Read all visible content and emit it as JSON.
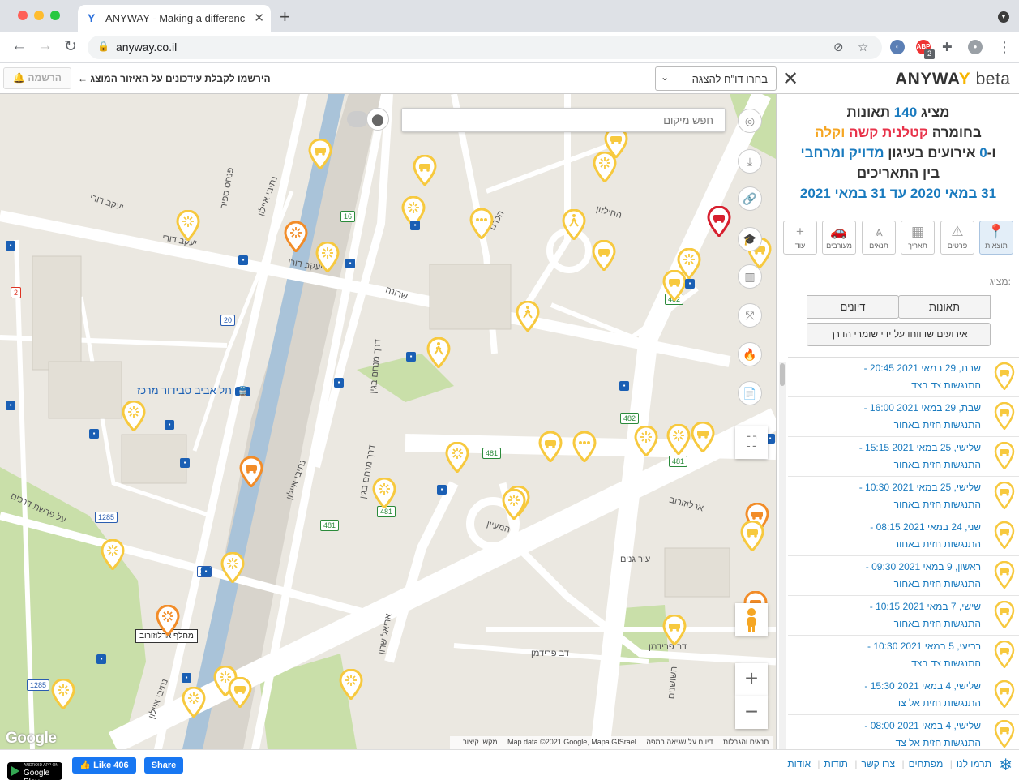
{
  "browser": {
    "tab_title": "ANYWAY - Making a difference",
    "url": "anyway.co.il",
    "extension_badge": "2"
  },
  "header": {
    "logo_main": "ANYWA",
    "logo_y": "Y",
    "logo_beta": "beta",
    "report_select_label": "בחרו דו\"ח להצגה",
    "register_label": "הרשמה",
    "register_text": "הירשמו לקבלת עידכונים על האיזור המוצג ←"
  },
  "map": {
    "search_placeholder": "חפש מיקום",
    "interchange_label": "מחלף ארלוזורוב",
    "station_label": "תל אביב סבידור מרכז",
    "attribution": {
      "report_error": "דיווח על שגיאה במפה",
      "terms": "תנאים והגבלות",
      "data": "Map data ©2021 Google, Mapa GISrael",
      "shortcuts": "מקשי קיצור"
    },
    "google_logo": "Google",
    "streets": [
      "יעקב דורי",
      "יעקב דורי",
      "יעקב דורי",
      "נתיבי איילון",
      "נתיבי איילון",
      "נתיבי איילון",
      "דרך מנחם בגין",
      "דרך מנחם בגין",
      "ארלוזורוב",
      "אריאל שרון",
      "דב פרידמן",
      "דב פרידמן",
      "עיר גנים",
      "פנחס ספיר",
      "שרונה",
      "הכרם",
      "החילזון",
      "המעיין",
      "על פרשת דרכים",
      "השושנים"
    ],
    "road_numbers": [
      "20",
      "20",
      "482",
      "482",
      "481",
      "481",
      "481",
      "16",
      "2",
      "1285",
      "1285"
    ]
  },
  "sidebar": {
    "summary": {
      "line1_prefix": "מציג",
      "count": "140",
      "line1_suffix": "תאונות",
      "line2_prefix": "בחומרה",
      "severe_fatal": "קטלנית קשה",
      "and_light": "וקלה",
      "line3_prefix": "ו-",
      "events_count": "0",
      "line3_mid": "אירועים בעיגון",
      "precision": "מדויק ומרחבי",
      "line4": "בין התאריכים",
      "dates": "31 במאי 2020 עד 31 במאי 2021"
    },
    "tabs": [
      {
        "label": "תוצאות",
        "icon": "pin-icon",
        "glyph": "📍"
      },
      {
        "label": "פרטים",
        "icon": "warning-icon",
        "glyph": "⚠"
      },
      {
        "label": "תאריך",
        "icon": "calendar-icon",
        "glyph": "▦"
      },
      {
        "label": "תנאים",
        "icon": "road-icon",
        "glyph": "⩓"
      },
      {
        "label": "מעורבים",
        "icon": "car-icon",
        "glyph": "🚗"
      },
      {
        "label": "עוד",
        "icon": "plus-icon",
        "glyph": "+"
      }
    ],
    "showing_label": "מציג:",
    "accidents_btn": "תאונות",
    "discussions_btn": "דיונים",
    "road_safety_btn": "אירועים שדווחו על ידי שומרי הדרך",
    "items": [
      {
        "date": "שבת, 29 במאי 2021 20:45 -",
        "type": "התנגשות צד בצד"
      },
      {
        "date": "שבת, 29 במאי 2021 16:00 -",
        "type": "התנגשות חזית באחור"
      },
      {
        "date": "שלישי, 25 במאי 2021 15:15 -",
        "type": "התנגשות חזית באחור"
      },
      {
        "date": "שלישי, 25 במאי 2021 10:30 -",
        "type": "התנגשות חזית באחור"
      },
      {
        "date": "שני, 24 במאי 2021 08:15 -",
        "type": "התנגשות חזית באחור"
      },
      {
        "date": "ראשון, 9 במאי 2021 09:30 -",
        "type": "התנגשות חזית באחור"
      },
      {
        "date": "שישי, 7 במאי 2021 10:15 -",
        "type": "התנגשות חזית באחור"
      },
      {
        "date": "רביעי, 5 במאי 2021 10:30 -",
        "type": "התנגשות צד בצד"
      },
      {
        "date": "שלישי, 4 במאי 2021 15:30 -",
        "type": "התנגשות חזית אל צד"
      },
      {
        "date": "שלישי, 4 במאי 2021 08:00 -",
        "type": "התנגשות חזית אל צד"
      }
    ]
  },
  "footer": {
    "gplay_small": "ANDROID APP ON",
    "gplay": "Google Play",
    "like": "Like 406",
    "share": "Share",
    "links": [
      "תרמו לנו",
      "מפתחים",
      "צרו קשר",
      "תודות",
      "אודות"
    ]
  },
  "colors": {
    "accent": "#1a7bbf",
    "marker_light": "#f7c93e",
    "marker_severe": "#f28c28",
    "marker_fatal": "#d71f2e",
    "map_bg": "#ebe8e1",
    "map_road": "#ffffff",
    "map_park": "#c9dfa9"
  }
}
